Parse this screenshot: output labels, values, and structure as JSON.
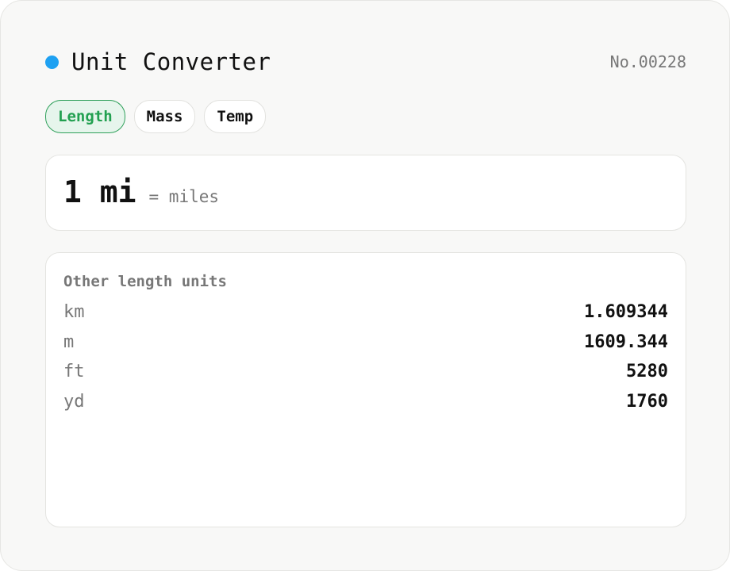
{
  "header": {
    "title": "Unit Converter",
    "serial": "No.00228",
    "dot_color": "#1ea1f2"
  },
  "tabs": [
    {
      "label": "Length",
      "active": true
    },
    {
      "label": "Mass",
      "active": false
    },
    {
      "label": "Temp",
      "active": false
    }
  ],
  "input": {
    "value": "1 mi",
    "unit_name": "= miles"
  },
  "results": {
    "heading": "Other length units",
    "rows": [
      {
        "unit": "km",
        "value": "1.609344"
      },
      {
        "unit": "m",
        "value": "1609.344"
      },
      {
        "unit": "ft",
        "value": "5280"
      },
      {
        "unit": "yd",
        "value": "1760"
      }
    ]
  },
  "colors": {
    "accent_green": "#22a050",
    "accent_green_bg": "#e6f5ec",
    "muted_text": "#777777"
  }
}
